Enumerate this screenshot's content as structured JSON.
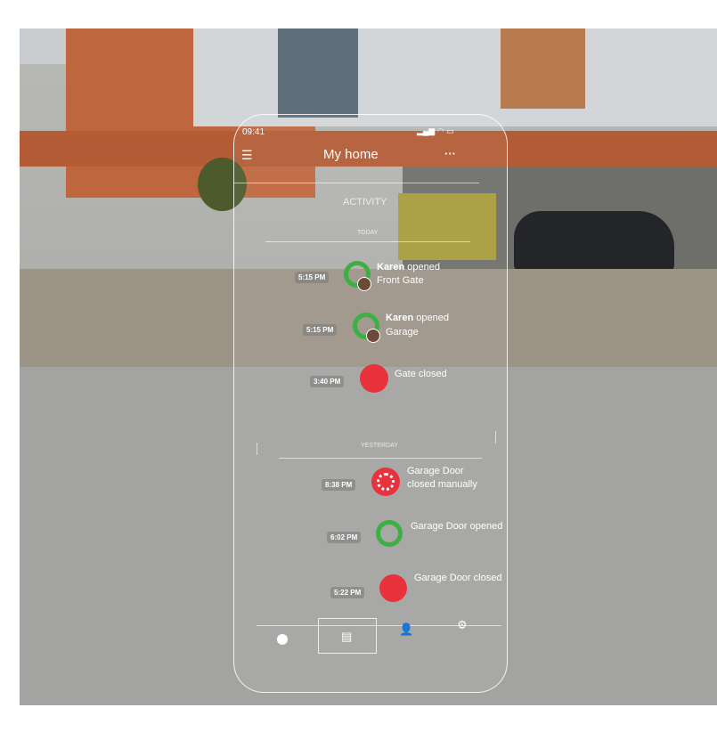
{
  "status_bar": {
    "time": "09:41"
  },
  "header": {
    "title": "My home",
    "menu_icon": "hamburger-icon",
    "more_icon": "ellipsis-icon"
  },
  "section_title": "ACTIVITY",
  "groups": [
    {
      "label": "TODAY",
      "items": [
        {
          "time": "5:15 PM",
          "name": "Karen",
          "action": "opened",
          "target": "Front Gate",
          "status": "open",
          "avatar": true
        },
        {
          "time": "5:15 PM",
          "name": "Karen",
          "action": "opened",
          "target": "Garage",
          "status": "open",
          "avatar": true
        },
        {
          "time": "3:40 PM",
          "text": "Gate closed",
          "status": "closed"
        }
      ]
    },
    {
      "label": "YESTERDAY",
      "items": [
        {
          "time": "8:38 PM",
          "text": "Garage Door",
          "text2": "closed manually",
          "status": "manual"
        },
        {
          "time": "6:02 PM",
          "text": "Garage Door opened",
          "status": "open"
        },
        {
          "time": "5:22 PM",
          "text": "Garage Door closed",
          "status": "closed"
        }
      ]
    }
  ],
  "colors": {
    "open": "#3cb043",
    "closed": "#e8323c"
  },
  "tabs": [
    {
      "icon": "home-dot-icon"
    },
    {
      "icon": "activity-list-icon",
      "active": true
    },
    {
      "icon": "users-icon"
    },
    {
      "icon": "gear-icon"
    }
  ]
}
